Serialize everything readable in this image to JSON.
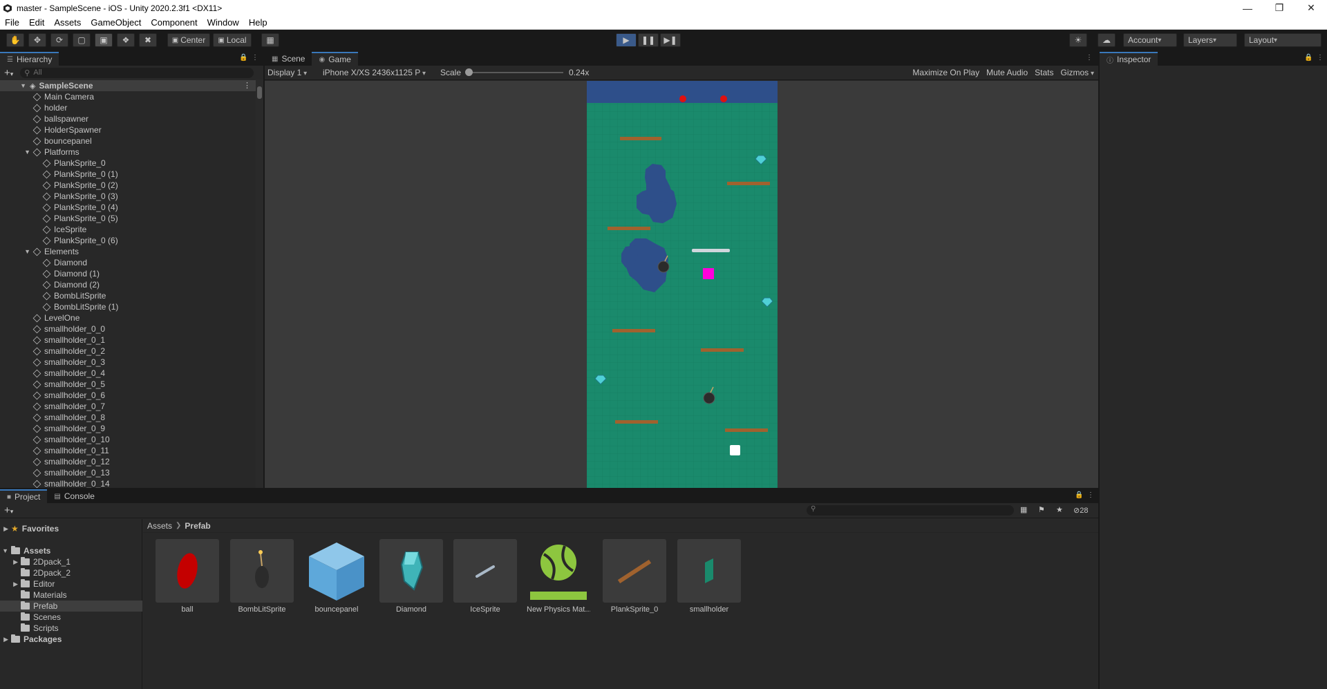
{
  "window": {
    "title": "master - SampleScene - iOS - Unity 2020.2.3f1 <DX11>"
  },
  "menu": [
    "File",
    "Edit",
    "Assets",
    "GameObject",
    "Component",
    "Window",
    "Help"
  ],
  "toolbar": {
    "pivot_center": "Center",
    "pivot_local": "Local",
    "account": "Account",
    "layers": "Layers",
    "layout": "Layout"
  },
  "hierarchy": {
    "tab": "Hierarchy",
    "search_placeholder": "All",
    "scene": "SampleScene",
    "items": [
      {
        "label": "Main Camera",
        "depth": 1
      },
      {
        "label": "holder",
        "depth": 1
      },
      {
        "label": "ballspawner",
        "depth": 1
      },
      {
        "label": "HolderSpawner",
        "depth": 1
      },
      {
        "label": "bouncepanel",
        "depth": 1
      },
      {
        "label": "Platforms",
        "depth": 1,
        "expanded": true
      },
      {
        "label": "PlankSprite_0",
        "depth": 2
      },
      {
        "label": "PlankSprite_0 (1)",
        "depth": 2
      },
      {
        "label": "PlankSprite_0 (2)",
        "depth": 2
      },
      {
        "label": "PlankSprite_0 (3)",
        "depth": 2
      },
      {
        "label": "PlankSprite_0 (4)",
        "depth": 2
      },
      {
        "label": "PlankSprite_0 (5)",
        "depth": 2
      },
      {
        "label": "IceSprite",
        "depth": 2
      },
      {
        "label": "PlankSprite_0 (6)",
        "depth": 2
      },
      {
        "label": "Elements",
        "depth": 1,
        "expanded": true
      },
      {
        "label": "Diamond",
        "depth": 2
      },
      {
        "label": "Diamond (1)",
        "depth": 2
      },
      {
        "label": "Diamond (2)",
        "depth": 2
      },
      {
        "label": "BombLitSprite",
        "depth": 2
      },
      {
        "label": "BombLitSprite (1)",
        "depth": 2
      },
      {
        "label": "LevelOne",
        "depth": 1
      },
      {
        "label": "smallholder_0_0",
        "depth": 1
      },
      {
        "label": "smallholder_0_1",
        "depth": 1
      },
      {
        "label": "smallholder_0_2",
        "depth": 1
      },
      {
        "label": "smallholder_0_3",
        "depth": 1
      },
      {
        "label": "smallholder_0_4",
        "depth": 1
      },
      {
        "label": "smallholder_0_5",
        "depth": 1
      },
      {
        "label": "smallholder_0_6",
        "depth": 1
      },
      {
        "label": "smallholder_0_7",
        "depth": 1
      },
      {
        "label": "smallholder_0_8",
        "depth": 1
      },
      {
        "label": "smallholder_0_9",
        "depth": 1
      },
      {
        "label": "smallholder_0_10",
        "depth": 1
      },
      {
        "label": "smallholder_0_11",
        "depth": 1
      },
      {
        "label": "smallholder_0_12",
        "depth": 1
      },
      {
        "label": "smallholder_0_13",
        "depth": 1
      },
      {
        "label": "smallholder_0_14",
        "depth": 1
      }
    ]
  },
  "game": {
    "tab_scene": "Scene",
    "tab_game": "Game",
    "display": "Display 1",
    "resolution": "iPhone X/XS 2436x1125 P",
    "scale_label": "Scale",
    "scale_value": "0.24x",
    "maximize": "Maximize On Play",
    "mute": "Mute Audio",
    "stats": "Stats",
    "gizmos": "Gizmos"
  },
  "inspector": {
    "tab": "Inspector"
  },
  "project": {
    "tab_project": "Project",
    "tab_console": "Console",
    "hidden_count": "28",
    "breadcrumb": [
      "Assets",
      "Prefab"
    ],
    "tree": [
      {
        "label": "Favorites",
        "depth": 0,
        "kind": "favorites"
      },
      {
        "label": "Assets",
        "depth": 0,
        "kind": "root"
      },
      {
        "label": "2Dpack_1",
        "depth": 1,
        "kind": "folder",
        "arrow": true
      },
      {
        "label": "2Dpack_2",
        "depth": 1,
        "kind": "folder"
      },
      {
        "label": "Editor",
        "depth": 1,
        "kind": "folder",
        "arrow": true
      },
      {
        "label": "Materials",
        "depth": 1,
        "kind": "folder"
      },
      {
        "label": "Prefab",
        "depth": 1,
        "kind": "folder",
        "selected": true
      },
      {
        "label": "Scenes",
        "depth": 1,
        "kind": "folder"
      },
      {
        "label": "Scripts",
        "depth": 1,
        "kind": "folder"
      },
      {
        "label": "Packages",
        "depth": 0,
        "kind": "root"
      }
    ],
    "assets": [
      {
        "label": "ball",
        "icon": "red-ball-icon"
      },
      {
        "label": "BombLitSprite",
        "icon": "bomb-icon"
      },
      {
        "label": "bouncepanel",
        "icon": "cube-icon"
      },
      {
        "label": "Diamond",
        "icon": "diamond-icon"
      },
      {
        "label": "IceSprite",
        "icon": "ice-icon"
      },
      {
        "label": "New Physics Mat...",
        "icon": "physics-material-icon"
      },
      {
        "label": "PlankSprite_0",
        "icon": "plank-icon"
      },
      {
        "label": "smallholder",
        "icon": "smallholder-icon"
      }
    ]
  },
  "colors": {
    "accent": "#3a79bb",
    "game_bg": "#1a8a6c",
    "game_top": "#2e4f8a"
  }
}
